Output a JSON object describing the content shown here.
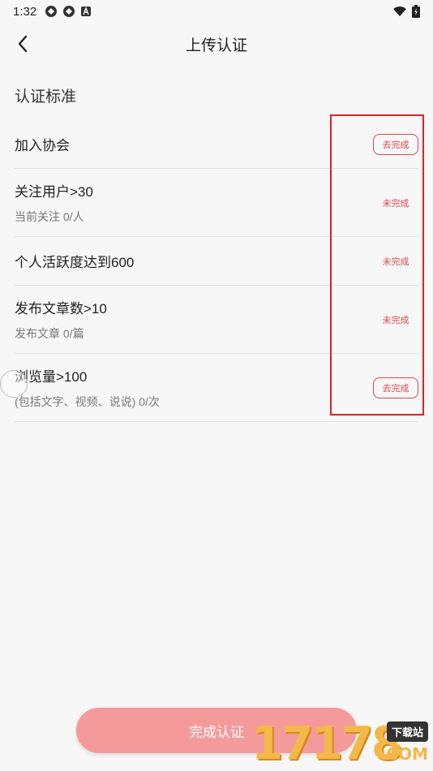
{
  "status_bar": {
    "time": "1:32"
  },
  "header": {
    "title": "上传认证"
  },
  "section": {
    "title": "认证标准"
  },
  "items": [
    {
      "title": "加入协会",
      "subtitle": "",
      "action": "去完成",
      "action_type": "button"
    },
    {
      "title": "关注用户>30",
      "subtitle": "当前关注 0/人",
      "action": "未完成",
      "action_type": "text"
    },
    {
      "title": "个人活跃度达到600",
      "subtitle": "",
      "action": "未完成",
      "action_type": "text"
    },
    {
      "title": "发布文章数>10",
      "subtitle": "发布文章 0/篇",
      "action": "未完成",
      "action_type": "text"
    },
    {
      "title": "浏览量>100",
      "subtitle": "(包括文字、视频、说说) 0/次",
      "action": "去完成",
      "action_type": "button"
    }
  ],
  "footer": {
    "complete_label": "完成认证"
  },
  "watermark": {
    "number": "17178",
    "tag": "下载站",
    "suffix": ".COM"
  },
  "colors": {
    "accent": "#e0474c",
    "button_bg": "#f59a9a",
    "highlight_box": "#e0202a"
  }
}
